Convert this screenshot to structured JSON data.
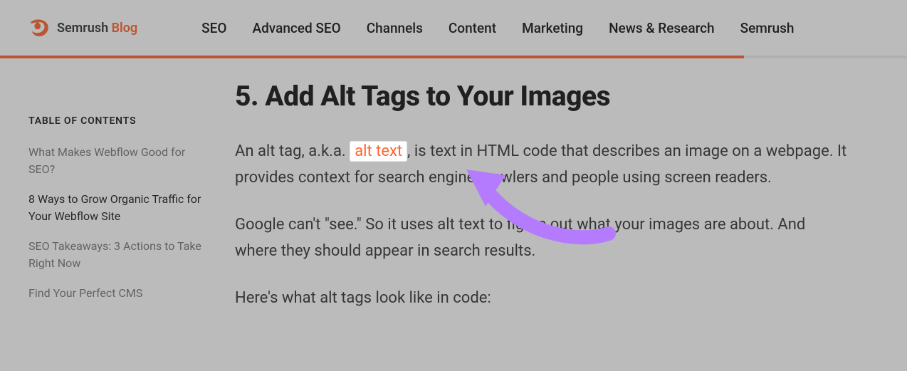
{
  "header": {
    "brand_name": "Semrush",
    "brand_suffix": "Blog",
    "nav": [
      "SEO",
      "Advanced SEO",
      "Channels",
      "Content",
      "Marketing",
      "News & Research",
      "Semrush"
    ]
  },
  "sidebar": {
    "toc_title": "TABLE OF CONTENTS",
    "items": [
      {
        "label": "What Makes Webflow Good for SEO?",
        "active": false
      },
      {
        "label": "8 Ways to Grow Organic Traffic for Your Webflow Site",
        "active": true
      },
      {
        "label": "SEO Takeaways: 3 Actions to Take Right Now",
        "active": false
      },
      {
        "label": "Find Your Perfect CMS",
        "active": false
      }
    ]
  },
  "article": {
    "heading": "5. Add Alt Tags to Your Images",
    "p1_pre": "An alt tag, a.k.a. ",
    "p1_link": "alt text",
    "p1_post": ", is text in HTML code that describes an image on a webpage. It provides context for search engine crawlers and people using screen readers.",
    "p2": "Google can't \"see.\" So it uses alt text to figure out what your images are about. And where they should appear in search results.",
    "p3": "Here's what alt tags look like in code:"
  }
}
